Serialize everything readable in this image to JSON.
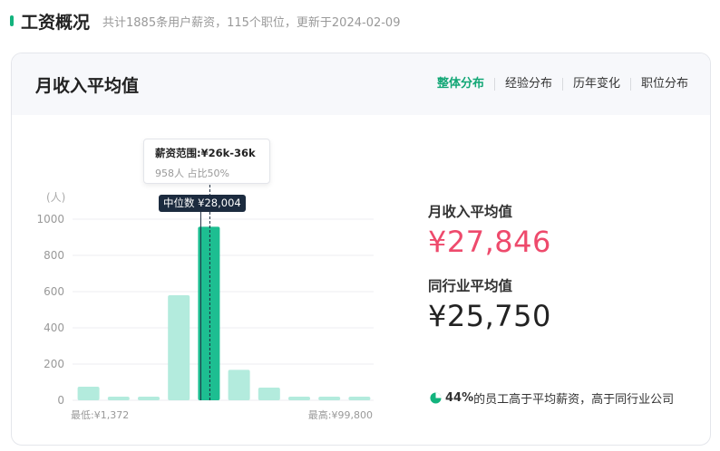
{
  "header": {
    "title": "工资概况",
    "subtitle": "共计1885条用户薪资，115个职位，更新于2024-02-09"
  },
  "card": {
    "title": "月收入平均值",
    "tabs": [
      {
        "label": "整体分布",
        "active": true
      },
      {
        "label": "经验分布",
        "active": false
      },
      {
        "label": "历年变化",
        "active": false
      },
      {
        "label": "职位分布",
        "active": false
      }
    ]
  },
  "tooltip": {
    "title": "薪资范围:¥26k-36k",
    "detail": "958人  占比50%"
  },
  "median_label": "中位数 ¥28,004",
  "stats": {
    "avg_label": "月收入平均值",
    "avg_value": "¥27,846",
    "industry_label": "同行业平均值",
    "industry_value": "¥25,750"
  },
  "note": {
    "percent": "44%",
    "text": "的员工高于平均薪资，",
    "emph": "高于同行业公司"
  },
  "colors": {
    "accent": "#13a776",
    "bar_light": "#b3ebdd",
    "bar_active": "#1dbe91",
    "pink": "#ee4a6c"
  },
  "chart_data": {
    "type": "bar",
    "y_unit": "(人)",
    "yticks": [
      0,
      200,
      400,
      600,
      800,
      1000
    ],
    "ylim": [
      0,
      1000
    ],
    "values": [
      75,
      20,
      20,
      580,
      958,
      168,
      70,
      20,
      20,
      20
    ],
    "active_index": 4,
    "min_label": "最低:¥1,372",
    "max_label": "最高:¥99,800",
    "grid": true
  }
}
